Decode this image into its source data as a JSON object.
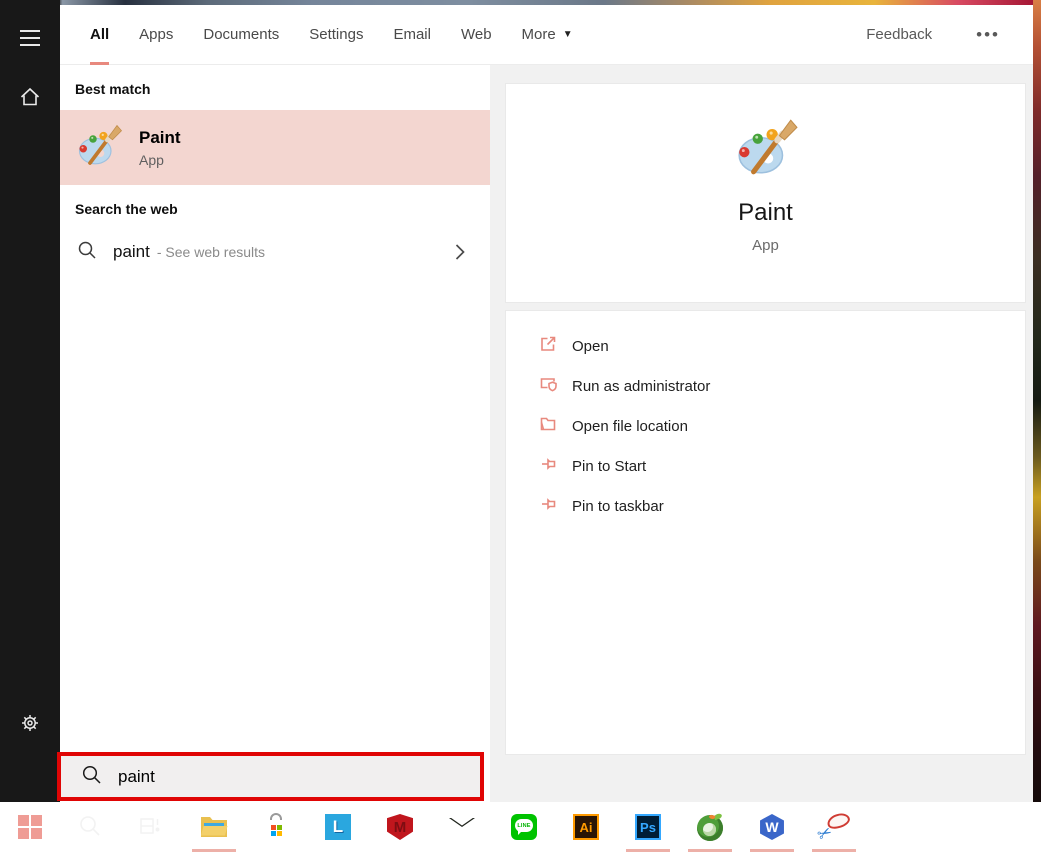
{
  "colors": {
    "accent_salmon": "#e8897e",
    "best_match_highlight": "#f3d6d0",
    "annotation_red": "#e00505",
    "running_indicator_pink": "#edb0a8",
    "left_rail_dark": "#181818",
    "preview_pane_gray": "#f1f1f1"
  },
  "tabs": {
    "items": [
      {
        "label": "All",
        "active": true
      },
      {
        "label": "Apps",
        "active": false
      },
      {
        "label": "Documents",
        "active": false
      },
      {
        "label": "Settings",
        "active": false
      },
      {
        "label": "Email",
        "active": false
      },
      {
        "label": "Web",
        "active": false
      },
      {
        "label": "More",
        "active": false,
        "has_dropdown": true
      }
    ],
    "feedback_label": "Feedback",
    "more_options_glyph": "•••"
  },
  "results": {
    "best_match_header": "Best match",
    "best_match": {
      "name": "Paint",
      "type": "App",
      "icon": "paint-app-icon"
    },
    "web_header": "Search the web",
    "web_result": {
      "query": "paint",
      "suffix": "- See web results",
      "icon": "search-icon",
      "chevron": "chevron-right-icon"
    }
  },
  "preview": {
    "app_name": "Paint",
    "app_type": "App",
    "app_icon": "paint-app-icon",
    "actions": [
      {
        "label": "Open",
        "icon": "open-icon"
      },
      {
        "label": "Run as administrator",
        "icon": "shield-icon"
      },
      {
        "label": "Open file location",
        "icon": "folder-icon"
      },
      {
        "label": "Pin to Start",
        "icon": "pin-icon"
      },
      {
        "label": "Pin to taskbar",
        "icon": "pin-icon"
      }
    ]
  },
  "search_box": {
    "value": "paint",
    "icon": "search-icon"
  },
  "taskbar": {
    "apps": [
      {
        "name": "start",
        "running": false
      },
      {
        "name": "search",
        "running": false
      },
      {
        "name": "task-view",
        "running": false
      },
      {
        "name": "file-explorer",
        "running": true
      },
      {
        "name": "microsoft-store",
        "running": false
      },
      {
        "name": "l-app",
        "running": false,
        "logo_letter": "L"
      },
      {
        "name": "mcafee",
        "running": false,
        "logo_letter": "M"
      },
      {
        "name": "mail",
        "running": false
      },
      {
        "name": "line",
        "running": false,
        "logo_letter": "LINE"
      },
      {
        "name": "illustrator",
        "running": false,
        "logo_letter": "Ai"
      },
      {
        "name": "photoshop",
        "running": true,
        "logo_letter": "Ps"
      },
      {
        "name": "coccoc-browser",
        "running": true
      },
      {
        "name": "wps-office",
        "running": true,
        "logo_letter": "W"
      },
      {
        "name": "snipping-app",
        "running": true
      }
    ]
  }
}
